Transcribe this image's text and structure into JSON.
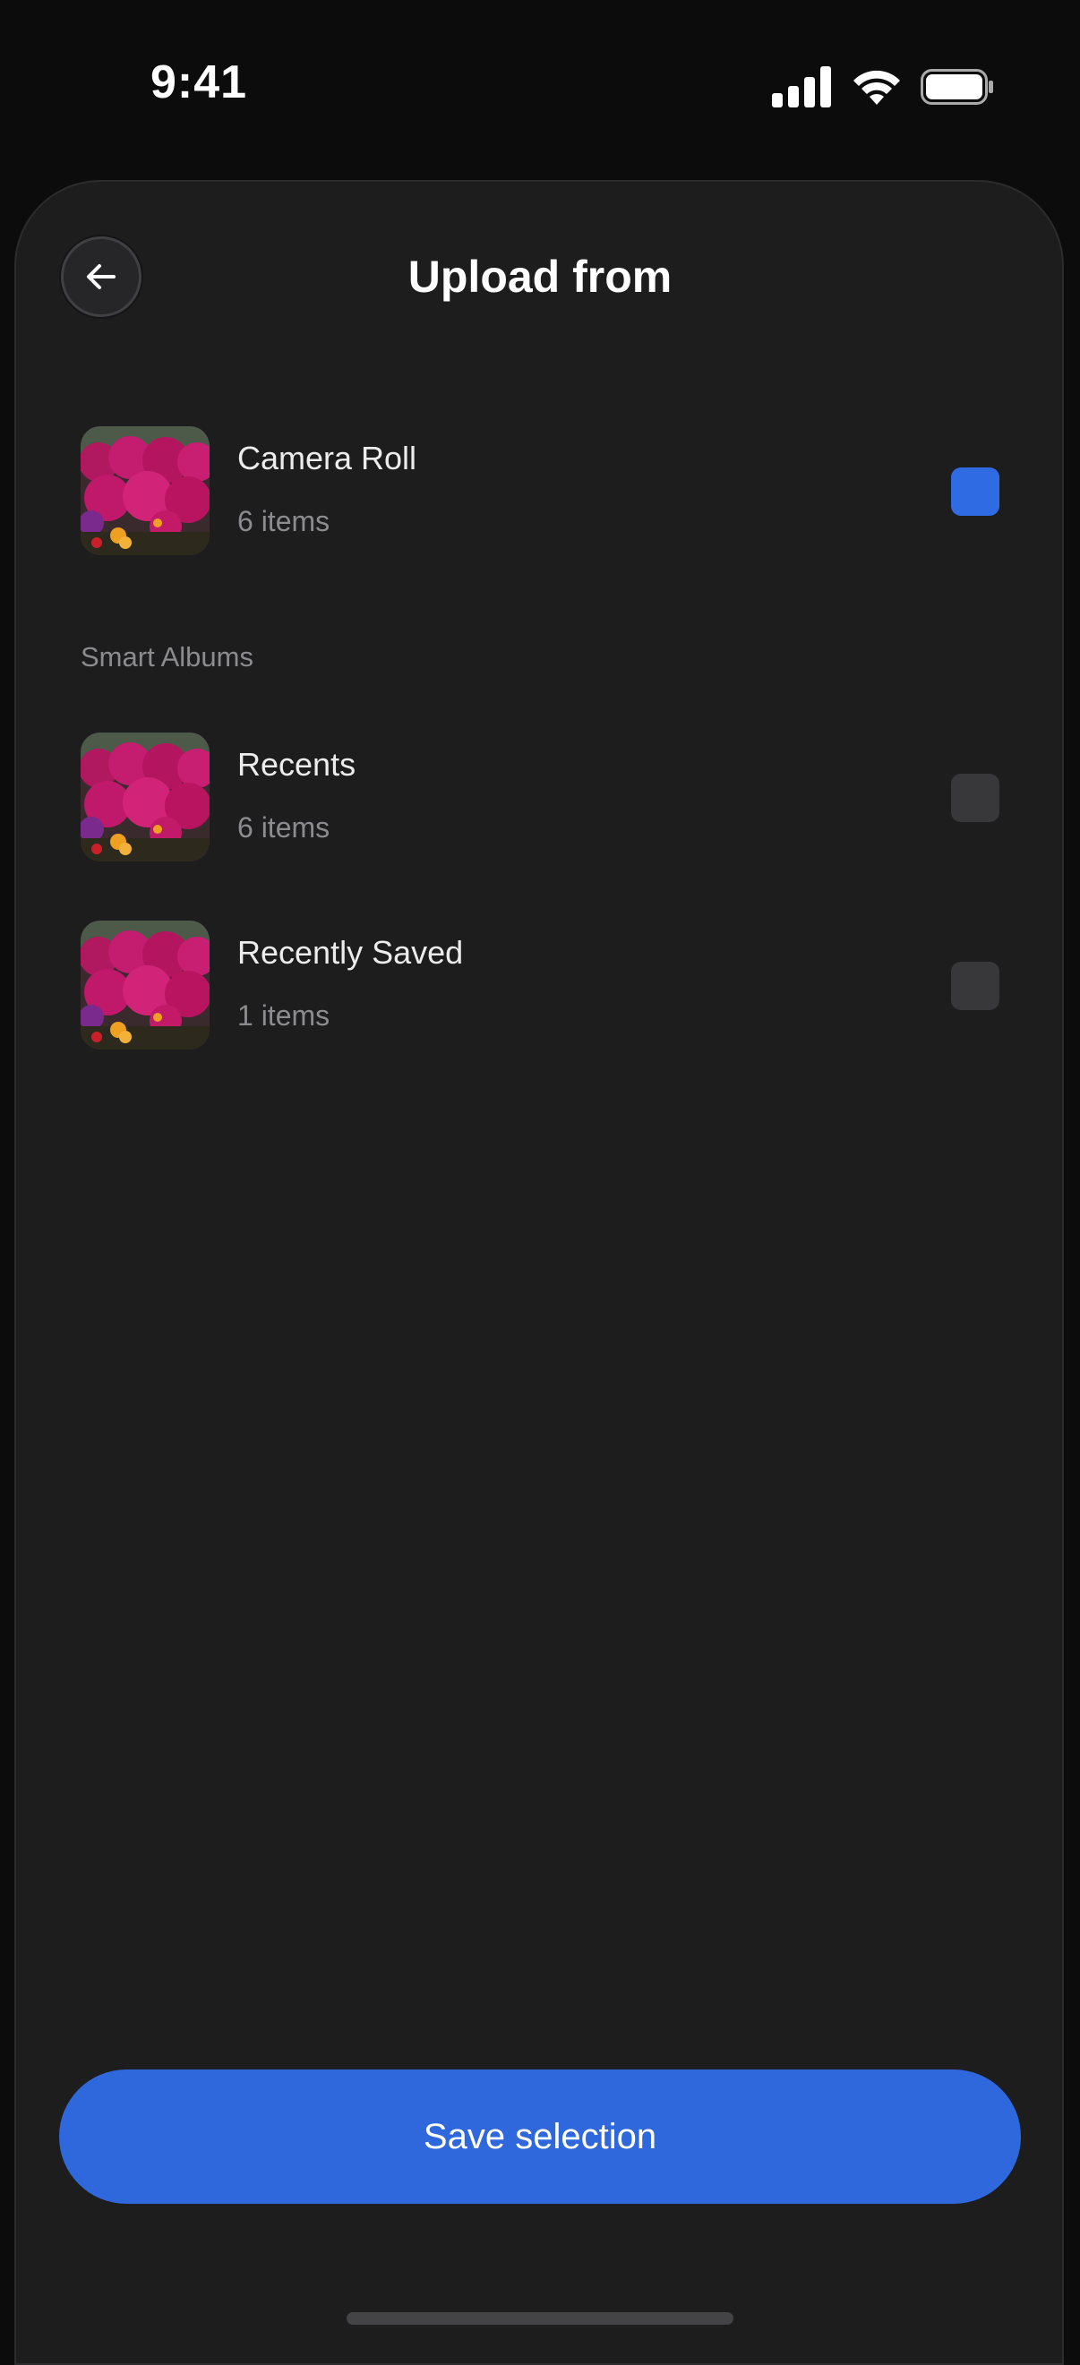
{
  "status_bar": {
    "time": "9:41"
  },
  "header": {
    "title": "Upload from",
    "back_icon": "arrow-left-icon"
  },
  "albums": [
    {
      "title": "Camera Roll",
      "count": "6 items",
      "checked": true
    }
  ],
  "smart_albums": {
    "label": "Smart Albums",
    "items": [
      {
        "title": "Recents",
        "count": "6 items",
        "checked": false
      },
      {
        "title": "Recently Saved",
        "count": "1 items",
        "checked": false
      }
    ]
  },
  "footer": {
    "save_label": "Save selection"
  },
  "colors": {
    "accent": "#2f68dc",
    "sheet": "#1d1d1e",
    "background": "#0c0c0d"
  }
}
